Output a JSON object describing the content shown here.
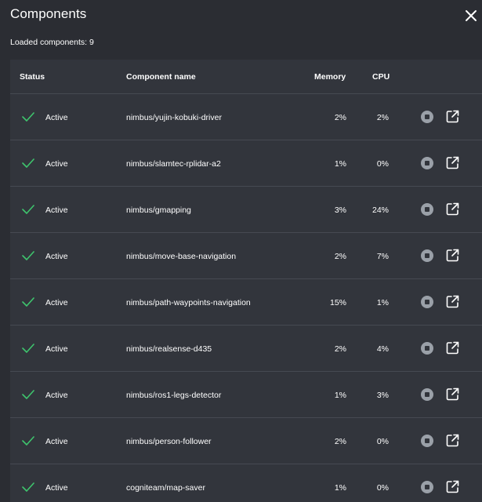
{
  "panel": {
    "title": "Components",
    "loaded_text": "Loaded components: 9"
  },
  "table": {
    "headers": {
      "status": "Status",
      "name": "Component name",
      "memory": "Memory",
      "cpu": "CPU"
    },
    "rows": [
      {
        "status": "Active",
        "name": "nimbus/yujin-kobuki-driver",
        "memory": "2%",
        "cpu": "2%"
      },
      {
        "status": "Active",
        "name": "nimbus/slamtec-rplidar-a2",
        "memory": "1%",
        "cpu": "0%"
      },
      {
        "status": "Active",
        "name": "nimbus/gmapping",
        "memory": "3%",
        "cpu": "24%"
      },
      {
        "status": "Active",
        "name": "nimbus/move-base-navigation",
        "memory": "2%",
        "cpu": "7%"
      },
      {
        "status": "Active",
        "name": "nimbus/path-waypoints-navigation",
        "memory": "15%",
        "cpu": "1%"
      },
      {
        "status": "Active",
        "name": "nimbus/realsense-d435",
        "memory": "2%",
        "cpu": "4%"
      },
      {
        "status": "Active",
        "name": "nimbus/ros1-legs-detector",
        "memory": "1%",
        "cpu": "3%"
      },
      {
        "status": "Active",
        "name": "nimbus/person-follower",
        "memory": "2%",
        "cpu": "0%"
      },
      {
        "status": "Active",
        "name": "cogniteam/map-saver",
        "memory": "1%",
        "cpu": "0%"
      }
    ]
  },
  "icons": {
    "close": "close-icon",
    "status": "check-icon",
    "stop": "stop-circle-icon",
    "open": "open-external-icon"
  },
  "colors": {
    "background": "#2b2d33",
    "table_background": "#32353c",
    "divider": "#464a52",
    "active_check": "#3ec46d",
    "stop_icon": "#9aa0a8"
  }
}
